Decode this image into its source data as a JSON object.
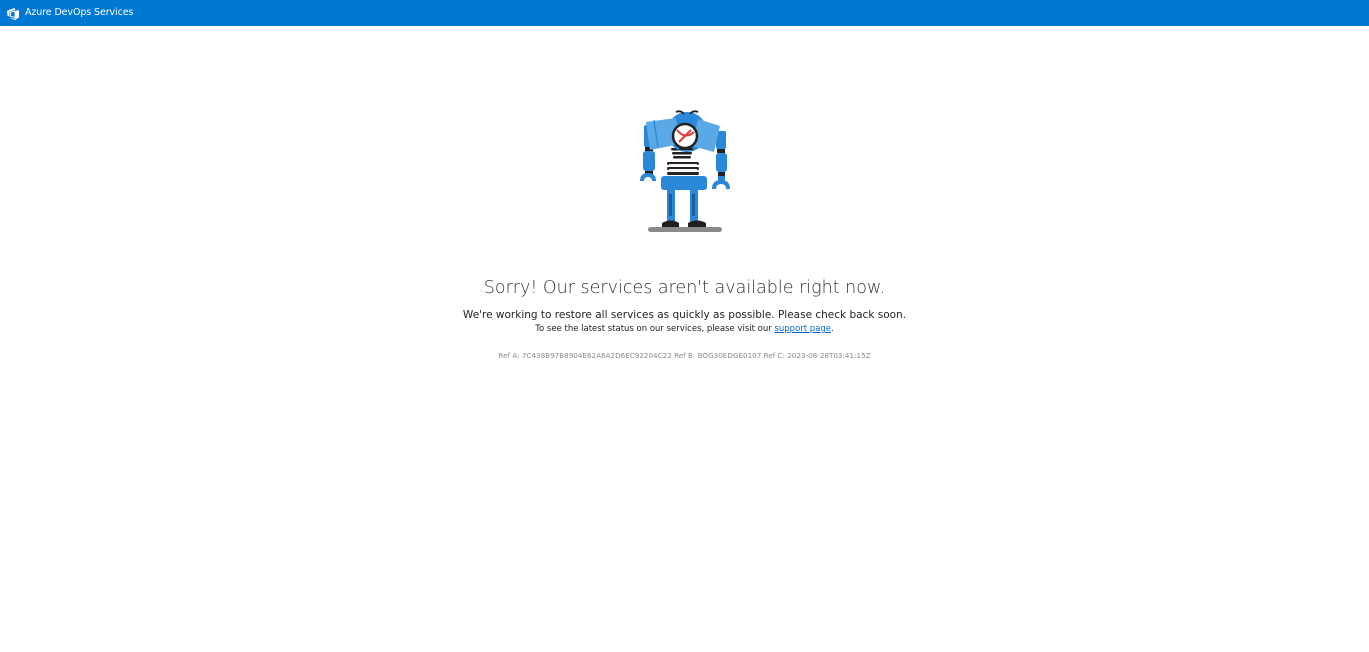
{
  "header": {
    "brand_name": "Azure DevOps Services",
    "background_color": "#0078d4",
    "logo_icon": "azure-devops-icon"
  },
  "error": {
    "illustration": "sad-robot-illustration",
    "title": "Sorry! Our services aren't available right now.",
    "message": "We're working to restore all services as quickly as possible. Please check back soon.",
    "status_prefix": "To see the latest status on our services, please visit our ",
    "support_link_label": "support page",
    "status_suffix": ".",
    "ref_text": "Ref A: 7C438B97B8904E62A6A2D6EC92204C22 Ref B: BOG30EDGE0107 Ref C: 2023-08-28T03:41:15Z"
  },
  "colors": {
    "robot_blue": "#2b88d8",
    "robot_light": "#5aa9e6",
    "link": "#0066cc"
  }
}
